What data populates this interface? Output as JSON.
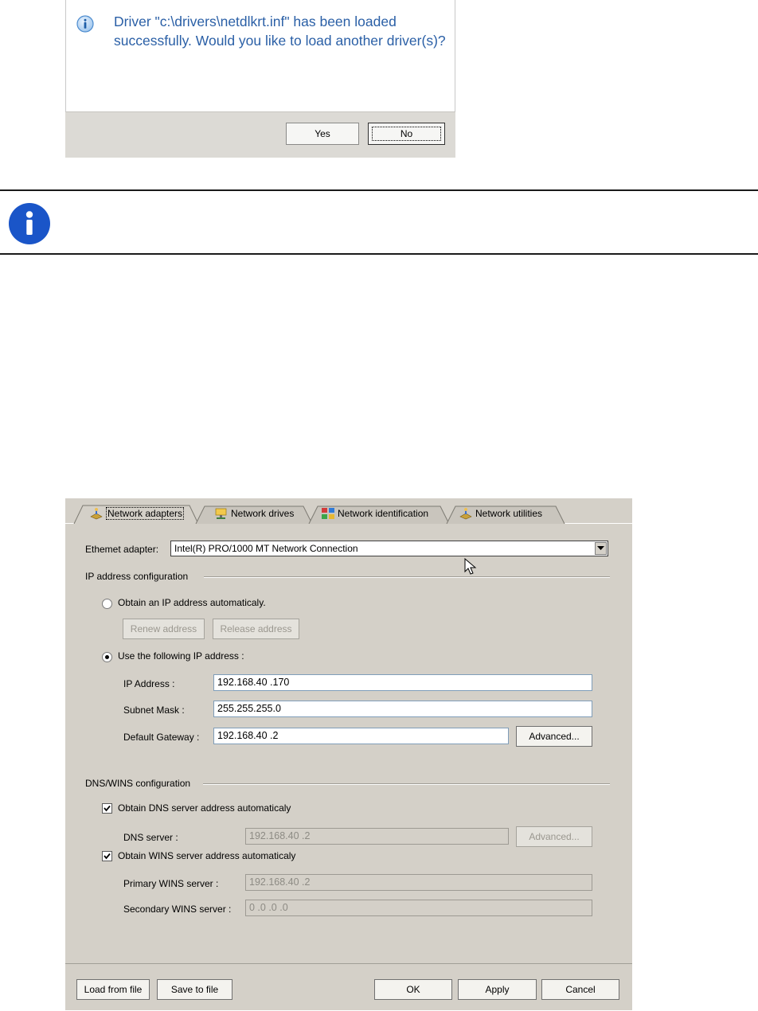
{
  "message_dialog": {
    "text": "Driver \"c:\\drivers\\netdlkrt.inf\" has been loaded successfully. Would you like to load another driver(s)?",
    "yes_label": "Yes",
    "no_label": "No",
    "text_color": "#2a5fa6"
  },
  "note": {
    "icon": "info-icon",
    "accent": "#1a55c8"
  },
  "network_dialog": {
    "tabs": [
      {
        "label": "Network adapters",
        "icon": "network-adapters-icon",
        "active": true
      },
      {
        "label": "Network drives",
        "icon": "network-drives-icon"
      },
      {
        "label": "Network identification",
        "icon": "network-identification-icon"
      },
      {
        "label": "Network utilities",
        "icon": "network-utilities-icon"
      }
    ],
    "adapter_label": "Ethemet adapter:",
    "adapter_value": "Intel(R) PRO/1000 MT Network Connection",
    "ip_group_label": "IP address configuration",
    "obtain_ip_auto": "Obtain an IP address automaticaly.",
    "renew_label": "Renew address",
    "release_label": "Release address",
    "use_following": "Use the following IP address :",
    "ip_address_label": "IP Address :",
    "ip_address": "192.168.40 .170",
    "subnet_label": "Subnet Mask :",
    "subnet": "255.255.255.0",
    "gateway_label": "Default Gateway :",
    "gateway": "192.168.40 .2",
    "advanced_label": "Advanced...",
    "dns_group_label": "DNS/WINS configuration",
    "obtain_dns_auto": "Obtain DNS server address automaticaly",
    "dns_server_label": "DNS server :",
    "dns_server": "192.168.40 .2",
    "dns_advanced_label": "Advanced...",
    "obtain_wins_auto": "Obtain WINS server address automaticaly",
    "primary_wins_label": "Primary WINS server :",
    "primary_wins": "192.168.40 .2",
    "secondary_wins_label": "Secondary WINS server :",
    "secondary_wins": "0  .0  .0  .0",
    "load_label": "Load from file",
    "save_label": "Save to file",
    "ok_label": "OK",
    "apply_label": "Apply",
    "cancel_label": "Cancel"
  }
}
